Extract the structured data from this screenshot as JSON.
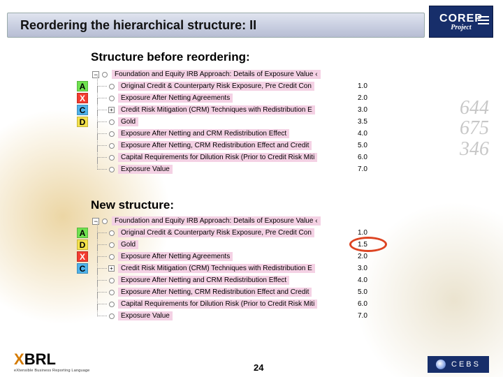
{
  "title": "Reordering the hierarchical structure: II",
  "logos": {
    "corep_l1": "COREP",
    "corep_l2": "Project",
    "xbrl": "XBRL",
    "xbrl_sub": "eXtensible Business Reporting Language",
    "cebs": "CEBS"
  },
  "page_number": "24",
  "bg_numbers": [
    "644",
    "675",
    "346"
  ],
  "sections": {
    "before_title": "Structure before reordering:",
    "after_title": "New structure:"
  },
  "tree_before": {
    "header": "Foundation and Equity IRB Approach: Details of Exposure Value ‹",
    "rows": [
      {
        "marker": "A",
        "marker_class": "mk-a",
        "label": "Original Credit & Counterparty Risk Exposure, Pre Credit Con",
        "order": "1.0",
        "exp": ""
      },
      {
        "marker": "X",
        "marker_class": "mk-x",
        "label": "Exposure After Netting Agreements",
        "order": "2.0",
        "exp": ""
      },
      {
        "marker": "C",
        "marker_class": "mk-c",
        "label": "Credit Risk Mitigation (CRM) Techniques with Redistribution E",
        "order": "3.0",
        "exp": "+"
      },
      {
        "marker": "D",
        "marker_class": "mk-d",
        "label": "Gold",
        "order": "3.5",
        "exp": ""
      },
      {
        "marker": "",
        "marker_class": "",
        "label": "Exposure After Netting and CRM Redistribution Effect",
        "order": "4.0",
        "exp": ""
      },
      {
        "marker": "",
        "marker_class": "",
        "label": "Exposure After Netting, CRM Redistribution Effect and Credit",
        "order": "5.0",
        "exp": ""
      },
      {
        "marker": "",
        "marker_class": "",
        "label": "Capital Requirements for Dilution Risk (Prior to Credit Risk Miti",
        "order": "6.0",
        "exp": ""
      },
      {
        "marker": "",
        "marker_class": "",
        "label": "Exposure Value",
        "order": "7.0",
        "exp": ""
      }
    ]
  },
  "tree_after": {
    "header": "Foundation and Equity IRB Approach: Details of Exposure Value ‹",
    "rows": [
      {
        "marker": "A",
        "marker_class": "mk-a",
        "label": "Original Credit & Counterparty Risk Exposure, Pre Credit Con",
        "order": "1.0",
        "exp": ""
      },
      {
        "marker": "D",
        "marker_class": "mk-d",
        "label": "Gold",
        "order": "1.5",
        "exp": "",
        "circle": true
      },
      {
        "marker": "X",
        "marker_class": "mk-x",
        "label": "Exposure After Netting Agreements",
        "order": "2.0",
        "exp": ""
      },
      {
        "marker": "C",
        "marker_class": "mk-c",
        "label": "Credit Risk Mitigation (CRM) Techniques with Redistribution E",
        "order": "3.0",
        "exp": "+"
      },
      {
        "marker": "",
        "marker_class": "",
        "label": "Exposure After Netting and CRM Redistribution Effect",
        "order": "4.0",
        "exp": ""
      },
      {
        "marker": "",
        "marker_class": "",
        "label": "Exposure After Netting, CRM Redistribution Effect and Credit",
        "order": "5.0",
        "exp": ""
      },
      {
        "marker": "",
        "marker_class": "",
        "label": "Capital Requirements for Dilution Risk (Prior to Credit Risk Miti",
        "order": "6.0",
        "exp": ""
      },
      {
        "marker": "",
        "marker_class": "",
        "label": "Exposure Value",
        "order": "7.0",
        "exp": ""
      }
    ]
  }
}
